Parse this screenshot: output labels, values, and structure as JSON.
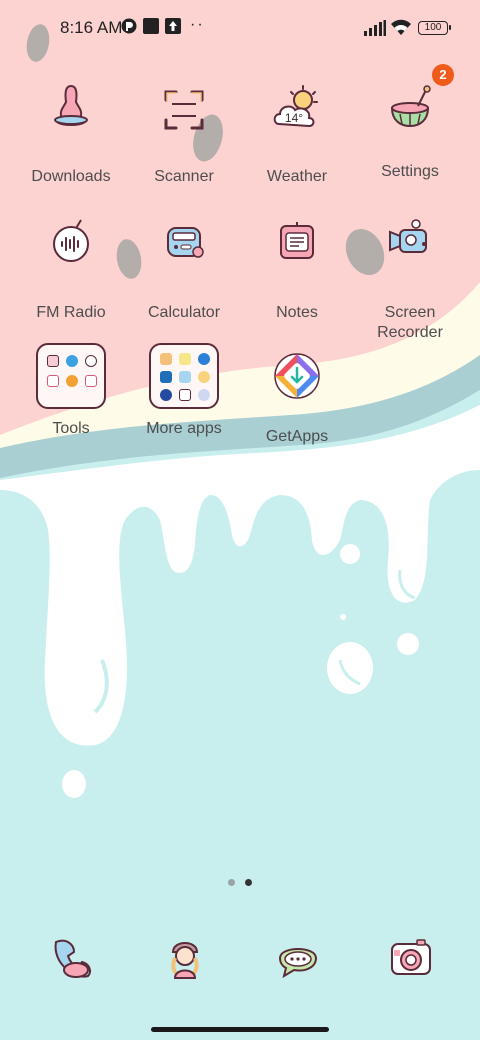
{
  "status_bar": {
    "time": "8:16 AM",
    "dots": "··",
    "battery": "100"
  },
  "apps": [
    {
      "label": "Downloads",
      "icon": "downloads-icon"
    },
    {
      "label": "Scanner",
      "icon": "scanner-icon"
    },
    {
      "label": "Weather",
      "icon": "weather-icon",
      "temp": "14°"
    },
    {
      "label": "Settings",
      "icon": "settings-icon",
      "badge": "2"
    },
    {
      "label": "FM Radio",
      "icon": "fm-radio-icon"
    },
    {
      "label": "Calculator",
      "icon": "calculator-icon"
    },
    {
      "label": "Notes",
      "icon": "notes-icon"
    },
    {
      "label": "Screen Recorder",
      "icon": "screen-recorder-icon"
    },
    {
      "label": "Tools",
      "icon": "tools-folder-icon"
    },
    {
      "label": "More apps",
      "icon": "more-apps-folder-icon"
    },
    {
      "label": "GetApps",
      "icon": "getapps-icon"
    }
  ],
  "dock": [
    "phone-icon",
    "contacts-icon",
    "messages-icon",
    "camera-icon"
  ],
  "pager": {
    "pages": 2,
    "current": 2
  },
  "colors": {
    "pink": "#fdd3d2",
    "mint": "#c9eeee",
    "badge": "#f05a1a",
    "outline": "#5a2b3a"
  }
}
